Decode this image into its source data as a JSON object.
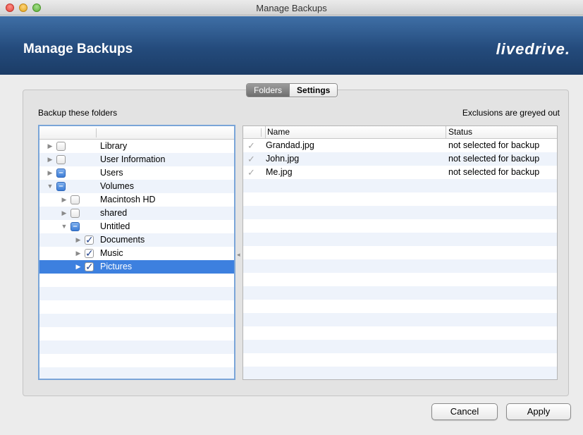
{
  "window": {
    "title": "Manage Backups"
  },
  "header": {
    "title": "Manage Backups",
    "brand": "livedrive."
  },
  "tabs": [
    {
      "label": "Folders",
      "active": true
    },
    {
      "label": "Settings",
      "active": false
    }
  ],
  "left_label": "Backup these folders",
  "right_label": "Exclusions are greyed out",
  "tree": {
    "rows": [
      {
        "label": "Library",
        "state": "unchecked",
        "expanded": false,
        "level": 0
      },
      {
        "label": "User Information",
        "state": "unchecked",
        "expanded": false,
        "level": 0
      },
      {
        "label": "Users",
        "state": "mixed",
        "expanded": false,
        "level": 0
      },
      {
        "label": "Volumes",
        "state": "mixed",
        "expanded": true,
        "level": 0
      },
      {
        "label": "Macintosh HD",
        "state": "unchecked",
        "expanded": false,
        "level": 1
      },
      {
        "label": "shared",
        "state": "unchecked",
        "expanded": false,
        "level": 1
      },
      {
        "label": "Untitled",
        "state": "mixed",
        "expanded": true,
        "level": 1
      },
      {
        "label": "Documents",
        "state": "checked",
        "expanded": false,
        "level": 2
      },
      {
        "label": "Music",
        "state": "checked",
        "expanded": false,
        "level": 2
      },
      {
        "label": "Pictures",
        "state": "checked",
        "expanded": false,
        "level": 2,
        "selected": true
      }
    ]
  },
  "filelist": {
    "columns": {
      "name": "Name",
      "status": "Status"
    },
    "rows": [
      {
        "name": "Grandad.jpg",
        "status": "not selected for backup"
      },
      {
        "name": "John.jpg",
        "status": "not selected for backup"
      },
      {
        "name": "Me.jpg",
        "status": "not selected for backup"
      }
    ]
  },
  "buttons": {
    "cancel": "Cancel",
    "apply": "Apply"
  },
  "colors": {
    "header_top": "#3f6fa6",
    "header_bottom": "#1b3c66",
    "selection": "#3d80df",
    "tree_border": "#7aa5d8"
  }
}
